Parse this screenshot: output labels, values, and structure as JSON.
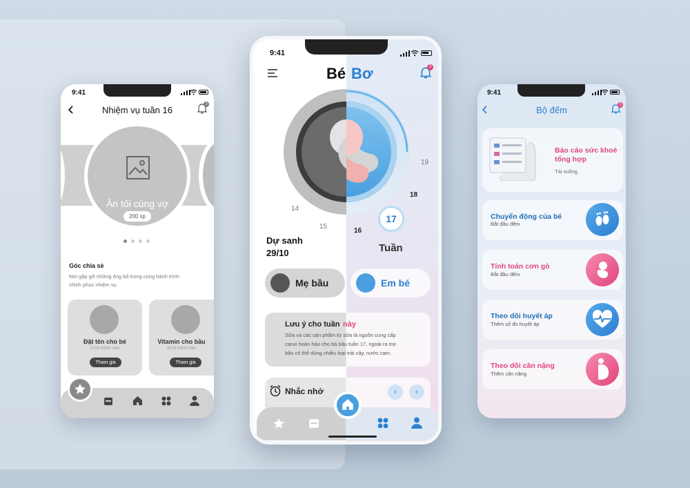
{
  "status_time": "9:41",
  "left_screen": {
    "title": "Nhiệm vụ tuần 16",
    "badge": "3",
    "mission_name": "Ăn tối cùng vợ",
    "mission_xp": "200 xp",
    "section_title": "Góc chia sẻ",
    "section_desc_1": "Nơi gặp gỡ những ông bố trong cùng hành trình",
    "section_desc_2": "chinh phục nhiệm vụ",
    "cards": [
      {
        "title": "Đặt tên cho bé",
        "members": "2103 thành viên",
        "button": "Tham gia"
      },
      {
        "title": "Vitamin cho bầu",
        "members": "3014 thành viên",
        "button": "Tham gia"
      }
    ]
  },
  "center_screen": {
    "brand_left": "Bé",
    "brand_right": "Bơ",
    "badge": "3",
    "weeks": [
      "14",
      "15",
      "16",
      "17",
      "18",
      "19"
    ],
    "due_label": "Dự sanh",
    "due_date": "29/10",
    "current_week": "17",
    "week_label": "Tuần",
    "tab_mom": "Mẹ bầu",
    "tab_baby": "Em bé",
    "note_title_a": "Lưu ý cho tuần",
    "note_title_b": " này",
    "note_body_1": "Sữa và các sản phẩm từ sữa là nguồn cung cấp",
    "note_body_2": "canxi hoàn hảo cho bà bầu tuần 17, ngoài ra mẹ",
    "note_body_3": "bầu có thể dùng nhiều loại trái cây, nước cam.",
    "reminder_title": "Nhắc nhở"
  },
  "right_screen": {
    "title": "Bộ đếm",
    "badge": "3",
    "items": [
      {
        "title_1": "Báo cáo sức khoẻ",
        "title_2": "tổng hợp",
        "sub": "Tải xuống",
        "color": "#e0457b"
      },
      {
        "title_1": "Chuyển động của bé",
        "sub": "Bắt đầu đếm",
        "color": "#1f6fb3"
      },
      {
        "title_1": "Tính toán cơn gò",
        "sub": "Bắt đầu đếm",
        "color": "#e0457b"
      },
      {
        "title_1": "Theo dõi huyết áp",
        "sub": "Thêm số đo huyết áp",
        "color": "#1f6fb3"
      },
      {
        "title_1": "Theo dõi cân nặng",
        "sub": "Thêm cân nặng",
        "color": "#e0457b"
      }
    ]
  },
  "colors": {
    "blue": "#2a7fd0",
    "pink": "#e0457b",
    "gray": "#9a9a9a"
  }
}
